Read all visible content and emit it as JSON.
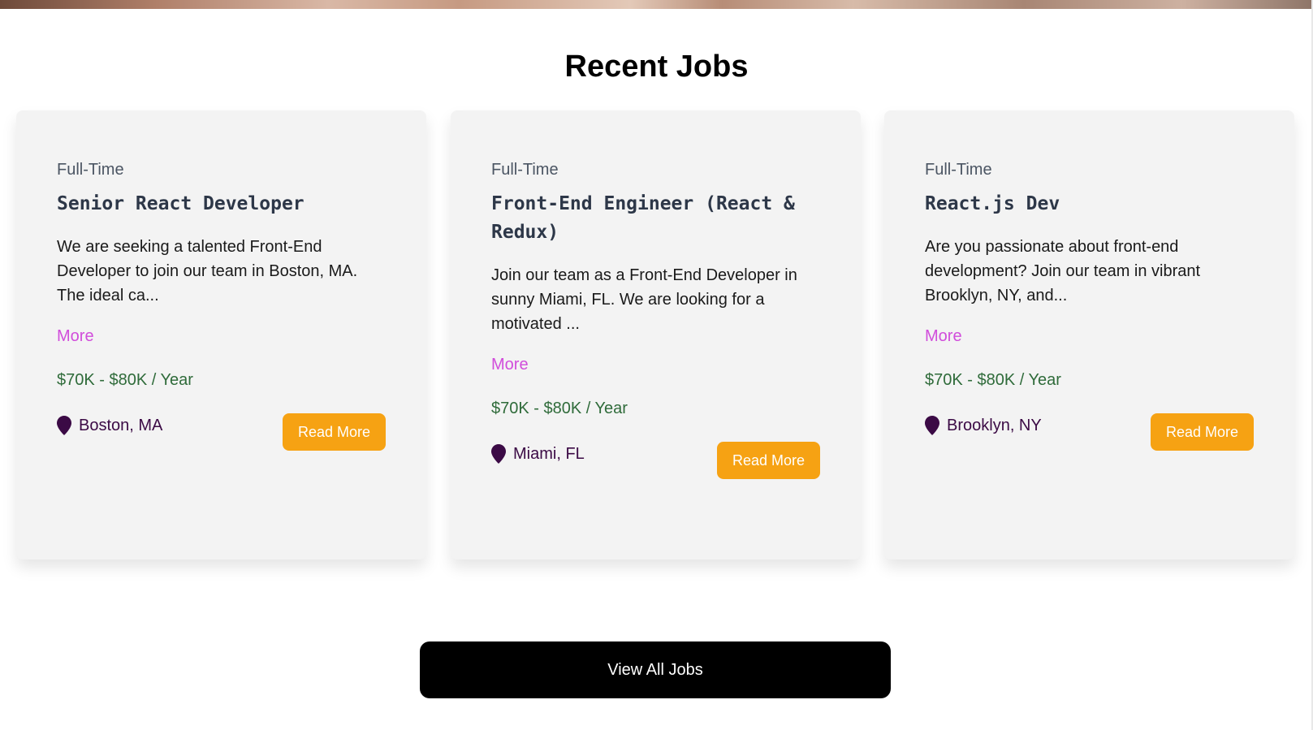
{
  "section": {
    "title": "Recent Jobs"
  },
  "jobs": [
    {
      "type": "Full-Time",
      "title": "Senior React Developer",
      "description": "We are seeking a talented Front-End Developer to join our team in Boston, MA. The ideal ca...",
      "more_label": "More",
      "salary": "$70K - $80K / Year",
      "location": "Boston, MA",
      "read_more_label": "Read More"
    },
    {
      "type": "Full-Time",
      "title": "Front-End Engineer (React & Redux)",
      "description": "Join our team as a Front-End Developer in sunny Miami, FL. We are looking for a motivated ...",
      "more_label": "More",
      "salary": "$70K - $80K / Year",
      "location": "Miami, FL",
      "read_more_label": "Read More"
    },
    {
      "type": "Full-Time",
      "title": "React.js Dev",
      "description": "Are you passionate about front-end development? Join our team in vibrant Brooklyn, NY, and...",
      "more_label": "More",
      "salary": "$70K - $80K / Year",
      "location": "Brooklyn, NY",
      "read_more_label": "Read More"
    }
  ],
  "view_all": {
    "label": "View All Jobs"
  },
  "icons": {
    "location": "map-pin-icon"
  },
  "colors": {
    "accent_orange": "#f6a213",
    "more_link": "#d14ddb",
    "salary_green": "#2f6b3a",
    "location_purple": "#3b0a45",
    "card_bg": "#f3f3f3"
  }
}
